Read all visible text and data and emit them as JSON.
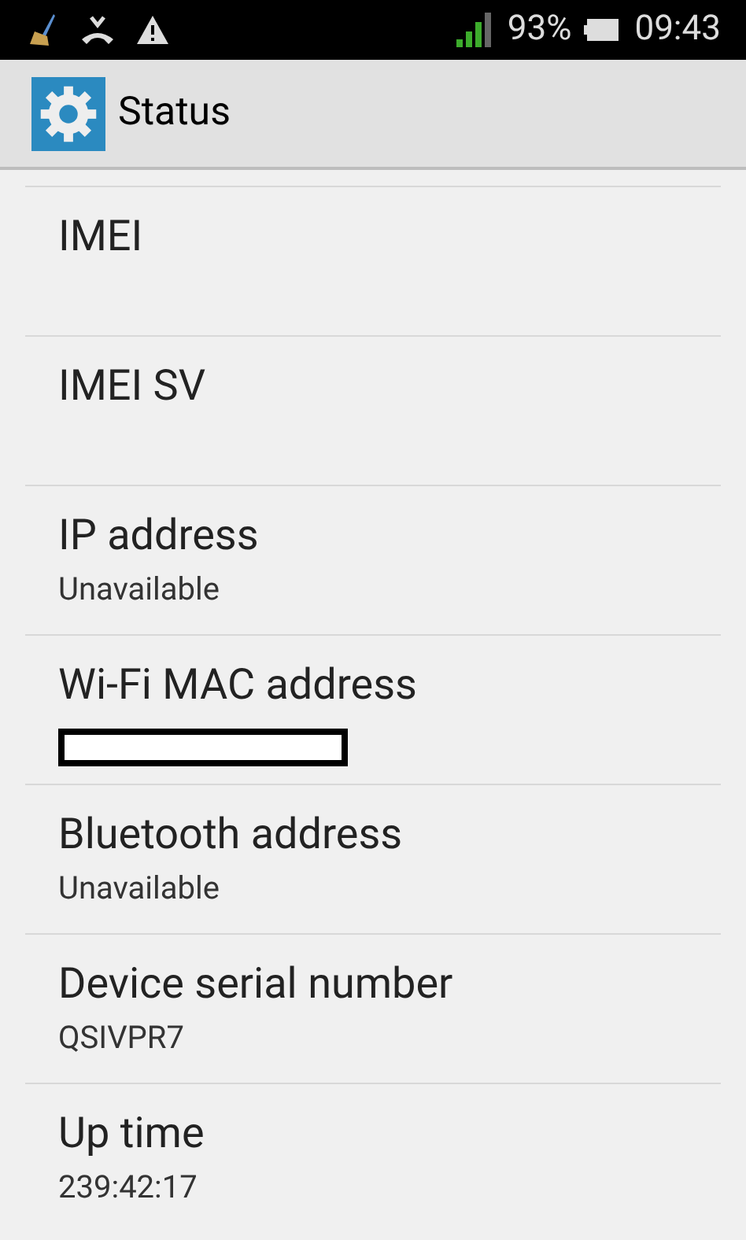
{
  "status_bar": {
    "battery": "93%",
    "time": "09:43"
  },
  "action_bar": {
    "title": "Status"
  },
  "items": [
    {
      "kind": "empty",
      "title": "IMEI"
    },
    {
      "kind": "empty",
      "title": "IMEI SV"
    },
    {
      "kind": "text",
      "title": "IP address",
      "value": "Unavailable"
    },
    {
      "kind": "redacted",
      "title": "Wi-Fi MAC address"
    },
    {
      "kind": "text",
      "title": "Bluetooth address",
      "value": "Unavailable"
    },
    {
      "kind": "text",
      "title": "Device serial number",
      "value": "QSIVPR7"
    },
    {
      "kind": "text",
      "title": "Up time",
      "value": "239:42:17"
    }
  ]
}
